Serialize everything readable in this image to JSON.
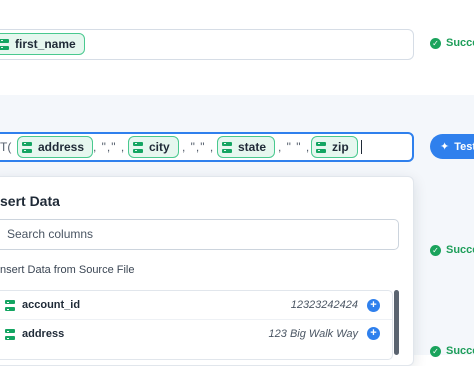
{
  "rows": [
    {
      "chips": [
        "first_name"
      ],
      "status": "Success"
    },
    {
      "function_prefix": "T(",
      "chips": [
        "address",
        "city",
        "state",
        "zip"
      ],
      "separators": [
        ", \",\" ,",
        ", \",\" ,",
        ", \" \" ,"
      ],
      "test_button": "Test"
    },
    {
      "status": "Success"
    },
    {
      "status": "Success"
    }
  ],
  "insert_panel": {
    "title": "sert Data",
    "search_placeholder": "Search columns",
    "section_label": "nsert Data from Source File",
    "columns": [
      {
        "name": "account_id",
        "sample": "12323242424"
      },
      {
        "name": "address",
        "sample": "123 Big Walk Way"
      }
    ]
  },
  "colors": {
    "accent": "#2f80ed",
    "chip_border": "#49c98f",
    "success": "#1aa35c"
  },
  "icons": [
    "database-icon",
    "check-circle-icon",
    "magic-wand-icon",
    "plus-circle-icon"
  ]
}
